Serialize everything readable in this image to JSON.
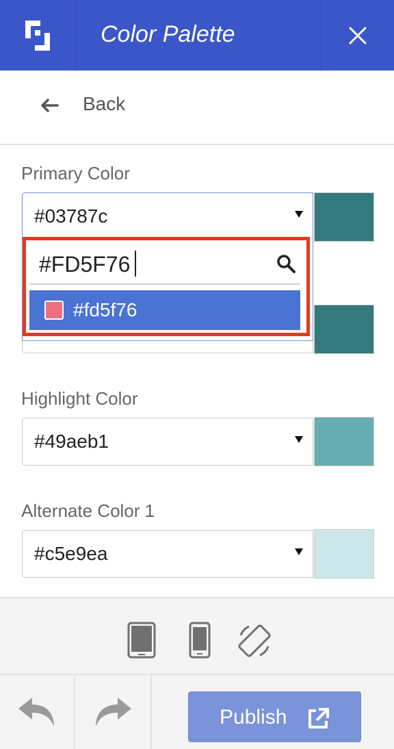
{
  "header": {
    "title": "Color Palette",
    "logo_icon": "brand-logo-icon",
    "close_icon": "close-icon"
  },
  "nav": {
    "back_label": "Back",
    "back_icon": "arrow-left-icon"
  },
  "fields": {
    "primary": {
      "label": "Primary Color",
      "value": "#03787c",
      "swatch": "#03787c"
    },
    "secondary": {
      "swatch": "#03787c"
    },
    "highlight": {
      "label": "Highlight Color",
      "value": "#49aeb1",
      "swatch": "#49aeb1"
    },
    "alternate1": {
      "label": "Alternate Color 1",
      "value": "#c5e9ea",
      "swatch": "#c5e9ea"
    }
  },
  "dropdown": {
    "search_value": "#FD5F76",
    "search_icon": "search-icon",
    "option_label": "#fd5f76",
    "option_color": "#fd5f76",
    "highlight_color": "#e63a1f"
  },
  "devices": {
    "tablet_icon": "tablet-icon",
    "phone_icon": "phone-icon",
    "rotate_icon": "rotate-icon"
  },
  "footer": {
    "undo_icon": "undo-icon",
    "redo_icon": "redo-icon",
    "publish_label": "Publish",
    "publish_icon": "external-link-icon"
  },
  "colors": {
    "header_bg": "#3a56c8",
    "option_bg": "#4a73d3",
    "publish_bg": "#7b93d8"
  }
}
